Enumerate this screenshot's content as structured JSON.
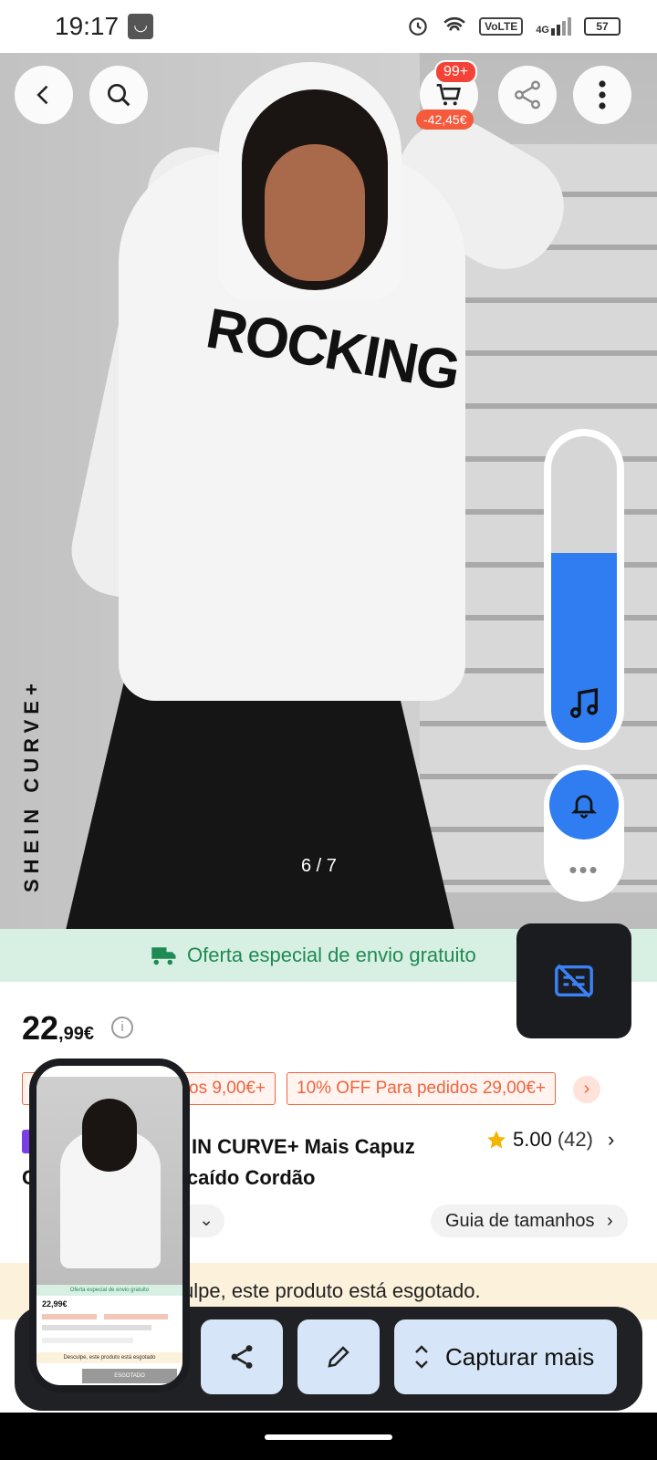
{
  "status_bar": {
    "time": "19:17",
    "network_label": "VoLTE",
    "signal_label": "4G",
    "battery": "57"
  },
  "product_image": {
    "brand_text": "SHEIN CURVE+",
    "print_text": "ROCKING",
    "counter": "6 / 7"
  },
  "header": {
    "cart_badge": "99+",
    "cart_discount": "-42,45€"
  },
  "volume_overlay": {
    "level_percent": 62
  },
  "shipping_banner": {
    "text": "Oferta especial de envio gratuito"
  },
  "price": {
    "integer": "22",
    "decimal": ",99€"
  },
  "coupons": [
    {
      "label": "dos 9,00€+"
    },
    {
      "label": "10% OFF Para pedidos 29,00€+"
    }
  ],
  "product": {
    "title_line1": "IN CURVE+ Mais Capuz",
    "title_line2": "C                  nbro caído Cordão",
    "rating": "5.00",
    "review_count": "(42)"
  },
  "size": {
    "guide_label": "Guia de tamanhos"
  },
  "soldout": {
    "text": "ulpe, este produto está esgotado."
  },
  "toolbar": {
    "capture_label": "Capturar mais"
  },
  "thumbnail": {
    "shipping_text": "Oferta especial de envio gratuito",
    "price_text": "22,99€",
    "soldout_text": "Desculpe, este produto está esgotado",
    "button_text": "ESGOTADO"
  },
  "colors": {
    "accent_blue": "#2f7df0",
    "coupon_orange": "#f0643c",
    "shipping_green": "#1f8a53"
  }
}
